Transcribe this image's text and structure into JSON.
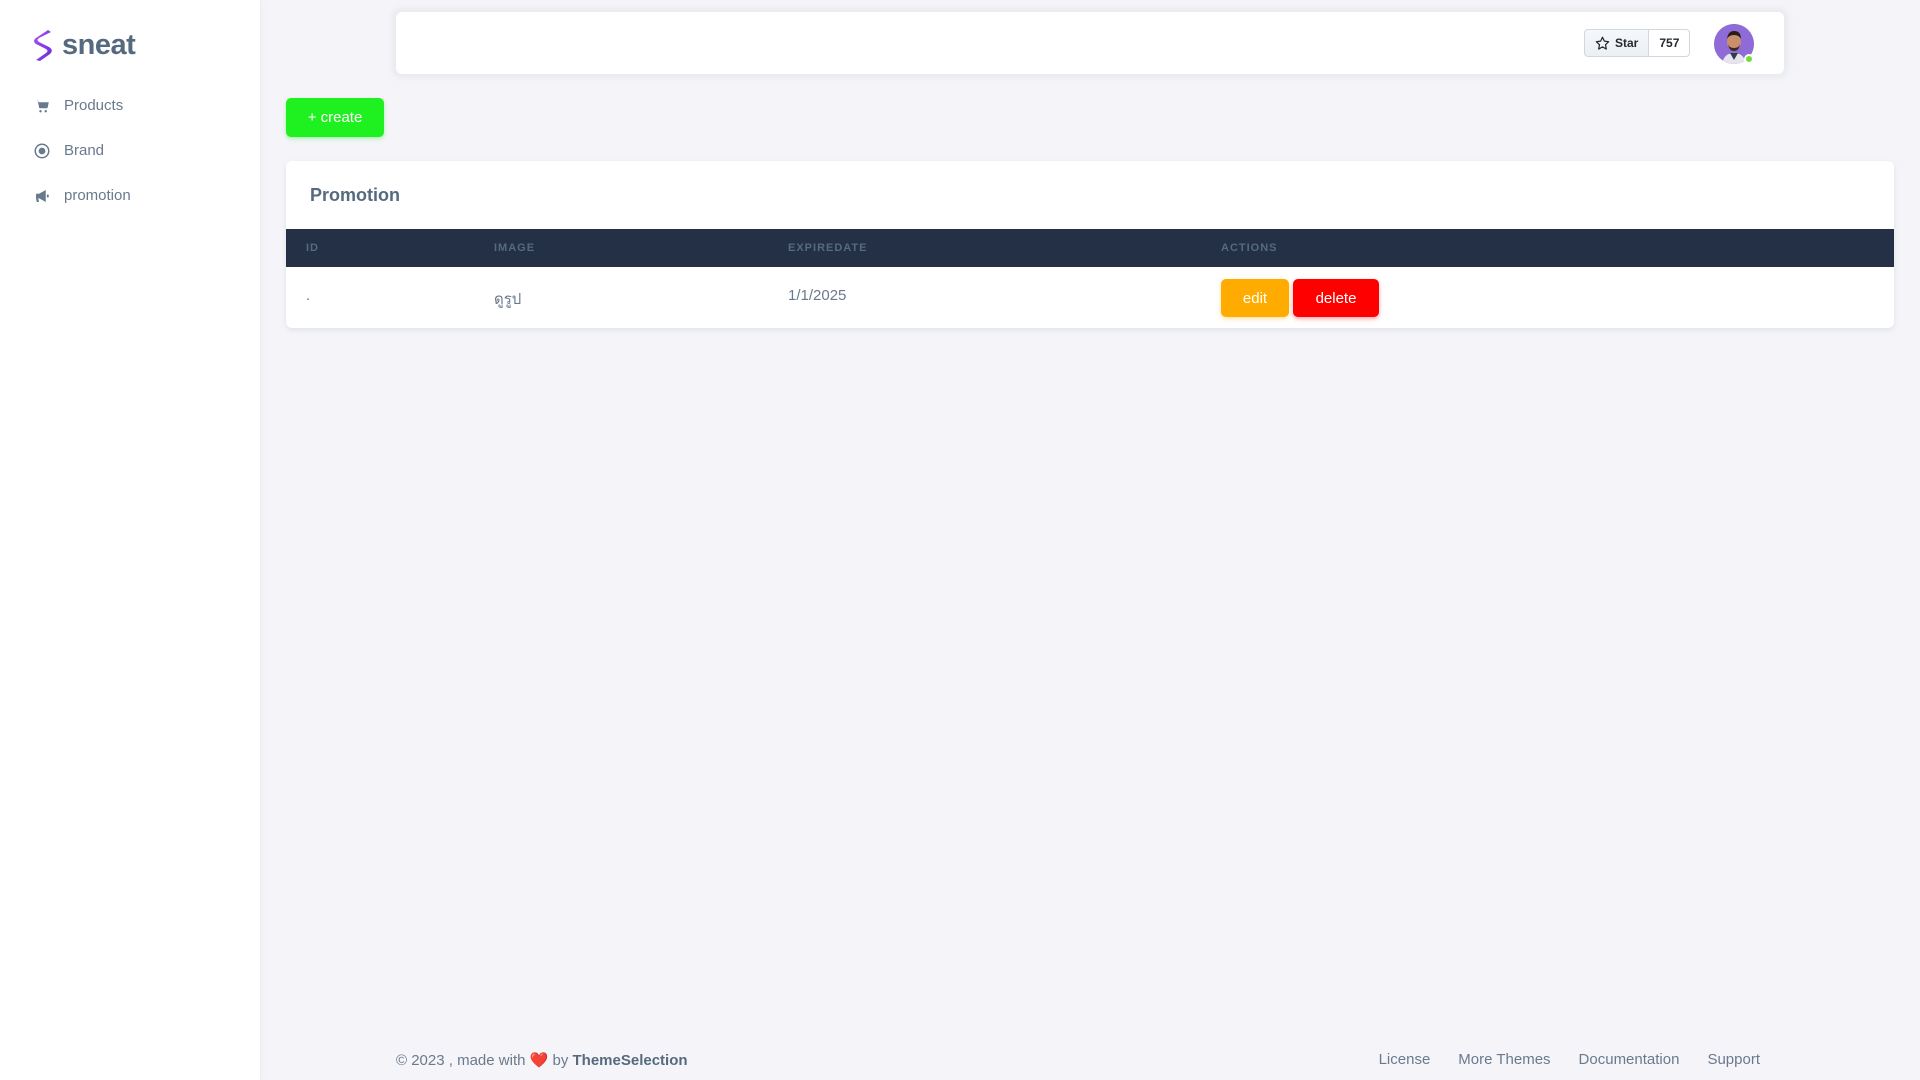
{
  "brand": {
    "name": "sneat",
    "accent": "#7c3aed"
  },
  "sidebar": {
    "items": [
      {
        "label": "Products",
        "icon": "cart-icon"
      },
      {
        "label": "Brand",
        "icon": "target-icon"
      },
      {
        "label": "promotion",
        "icon": "megaphone-icon"
      }
    ]
  },
  "navbar": {
    "github_star_label": "Star",
    "github_star_count": "757"
  },
  "toolbar": {
    "create_label": "+ create",
    "create_color": "#1ff01f"
  },
  "card": {
    "title": "Promotion",
    "columns": [
      "ID",
      "IMAGE",
      "EXPIREDATE",
      "ACTIONS"
    ],
    "rows": [
      {
        "id": ".",
        "image": "ดูรูป",
        "expiredate": "1/1/2025",
        "edit_label": "edit",
        "delete_label": "delete"
      }
    ]
  },
  "footer": {
    "copyright_prefix": "© 2023 , made with",
    "by": "by",
    "company": "ThemeSelection",
    "links": [
      "License",
      "More Themes",
      "Documentation",
      "Support"
    ]
  },
  "colors": {
    "edit": "#ffab00",
    "delete": "#ff0000",
    "table_header": "#233046"
  }
}
